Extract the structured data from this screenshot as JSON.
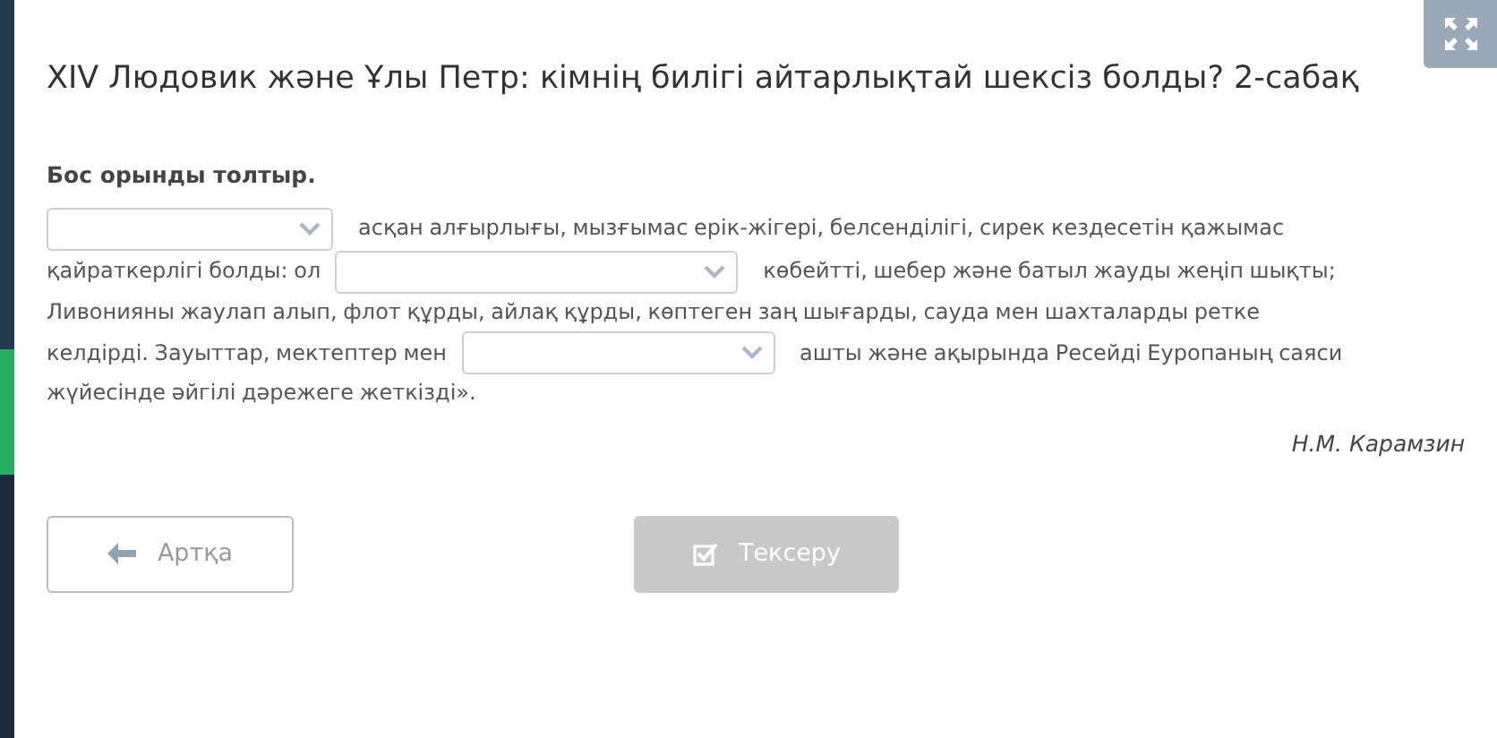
{
  "title": "XIV Людовик және Ұлы Петр: кімнің билігі айтарлықтай шексіз болды? 2-сабақ",
  "instruction": "Бос орынды толтыр.",
  "passage": [
    [
      {
        "kind": "blank"
      },
      {
        "kind": "text",
        "text": "асқан алғырлығы, мызғымас ерік-жігері, белсенділігі, сирек кездесетін қажымас"
      }
    ],
    [
      {
        "kind": "text",
        "text": "қайраткерлігі болды: ол"
      },
      {
        "kind": "blank"
      },
      {
        "kind": "text",
        "text": "көбейтті, шебер және батыл жауды жеңіп шықты;"
      }
    ],
    [
      {
        "kind": "text",
        "text": "Ливонияны жаулап алып, флот құрды, айлақ құрды, көптеген заң шығарды, сауда мен шахталарды ретке"
      }
    ],
    [
      {
        "kind": "text",
        "text": "келдірді. Зауыттар, мектептер мен"
      },
      {
        "kind": "blank"
      },
      {
        "kind": "text",
        "text": "ашты және ақырында Ресейді Еуропаның саяси"
      }
    ],
    [
      {
        "kind": "text",
        "text": "жүйесінде әйгілі дәрежеге жеткізді»."
      }
    ]
  ],
  "author": "Н.М. Карамзин",
  "buttons": [
    {
      "kind": "back",
      "label": "Артқа",
      "disabled": false
    },
    {
      "kind": "check",
      "label": "Тексеру",
      "disabled": true
    }
  ]
}
